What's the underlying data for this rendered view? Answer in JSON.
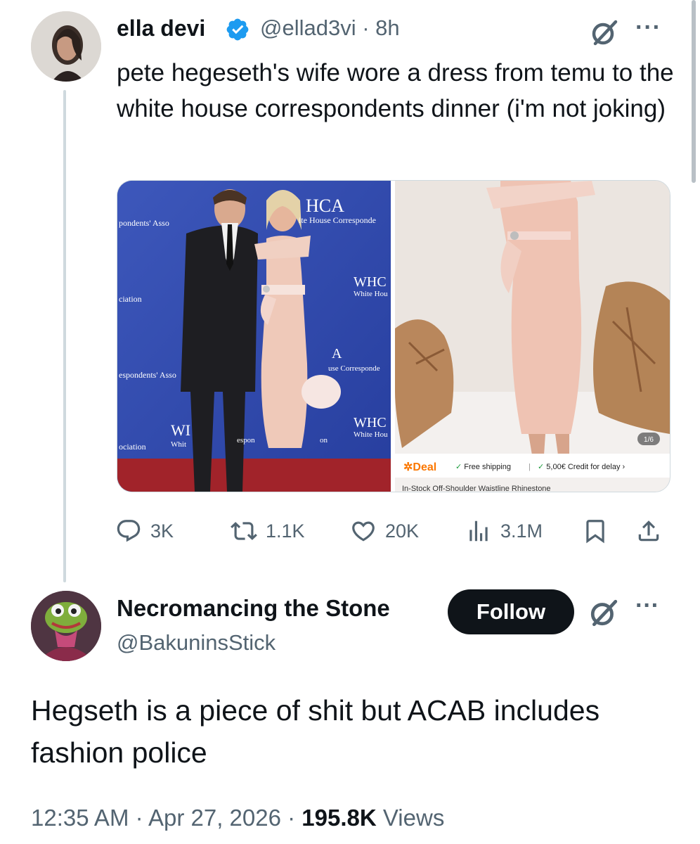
{
  "tweet1": {
    "author_name": "ella devi",
    "handle": "@ellad3vi",
    "separator": "·",
    "age": "8h",
    "more_label": "···",
    "text": "pete hegeseth's wife wore a dress from temu to the white house correspondents dinner (i'm not joking)",
    "media": {
      "left_signs": [
        "HCA",
        "ite House Corresponde",
        "pondents' Asso",
        "WHC",
        "White Hou",
        "ciation",
        "espondents' Asso",
        "use Corresponde",
        "A",
        "WHC",
        "White Hou",
        "WI",
        "Whit",
        "espon",
        "on",
        "ociation"
      ],
      "right": {
        "page_indicator": "1/6",
        "deal_label": "Deal",
        "free_shipping": "Free shipping",
        "divider": "|",
        "credit": "5,00€ Credit for delay",
        "chevron": "›",
        "product_title": "In-Stock Off-Shoulder Waistline Rhinestone"
      }
    },
    "actions": {
      "replies": "3K",
      "reposts": "1.1K",
      "likes": "20K",
      "views": "3.1M"
    }
  },
  "tweet2": {
    "author_name": "Necromancing the Stone",
    "handle": "@BakuninsStick",
    "follow_label": "Follow",
    "more_label": "···",
    "text": "Hegseth is a piece of shit but ACAB includes fashion police",
    "time": "12:35 AM",
    "sep1": "·",
    "date": "Apr 27, 2026",
    "sep2": "·",
    "views_count": "195.8K",
    "views_label": "Views"
  },
  "colors": {
    "text": "#0f1419",
    "secondary": "#536471",
    "verified": "#1d9bf0",
    "border": "#cfd9de",
    "temu_orange": "#fb7701"
  },
  "icons": [
    "verified-badge-icon",
    "grok-icon",
    "more-icon",
    "reply-icon",
    "repost-icon",
    "like-icon",
    "views-icon",
    "bookmark-icon",
    "share-icon"
  ]
}
